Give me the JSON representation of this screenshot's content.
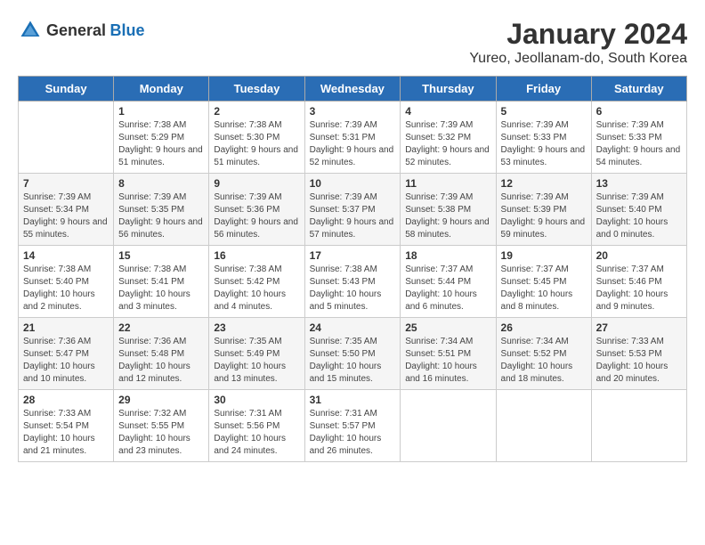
{
  "header": {
    "logo_general": "General",
    "logo_blue": "Blue",
    "month": "January 2024",
    "location": "Yureo, Jeollanam-do, South Korea"
  },
  "weekdays": [
    "Sunday",
    "Monday",
    "Tuesday",
    "Wednesday",
    "Thursday",
    "Friday",
    "Saturday"
  ],
  "weeks": [
    [
      {
        "day": "",
        "sunrise": "",
        "sunset": "",
        "daylight": ""
      },
      {
        "day": "1",
        "sunrise": "Sunrise: 7:38 AM",
        "sunset": "Sunset: 5:29 PM",
        "daylight": "Daylight: 9 hours and 51 minutes."
      },
      {
        "day": "2",
        "sunrise": "Sunrise: 7:38 AM",
        "sunset": "Sunset: 5:30 PM",
        "daylight": "Daylight: 9 hours and 51 minutes."
      },
      {
        "day": "3",
        "sunrise": "Sunrise: 7:39 AM",
        "sunset": "Sunset: 5:31 PM",
        "daylight": "Daylight: 9 hours and 52 minutes."
      },
      {
        "day": "4",
        "sunrise": "Sunrise: 7:39 AM",
        "sunset": "Sunset: 5:32 PM",
        "daylight": "Daylight: 9 hours and 52 minutes."
      },
      {
        "day": "5",
        "sunrise": "Sunrise: 7:39 AM",
        "sunset": "Sunset: 5:33 PM",
        "daylight": "Daylight: 9 hours and 53 minutes."
      },
      {
        "day": "6",
        "sunrise": "Sunrise: 7:39 AM",
        "sunset": "Sunset: 5:33 PM",
        "daylight": "Daylight: 9 hours and 54 minutes."
      }
    ],
    [
      {
        "day": "7",
        "sunrise": "Sunrise: 7:39 AM",
        "sunset": "Sunset: 5:34 PM",
        "daylight": "Daylight: 9 hours and 55 minutes."
      },
      {
        "day": "8",
        "sunrise": "Sunrise: 7:39 AM",
        "sunset": "Sunset: 5:35 PM",
        "daylight": "Daylight: 9 hours and 56 minutes."
      },
      {
        "day": "9",
        "sunrise": "Sunrise: 7:39 AM",
        "sunset": "Sunset: 5:36 PM",
        "daylight": "Daylight: 9 hours and 56 minutes."
      },
      {
        "day": "10",
        "sunrise": "Sunrise: 7:39 AM",
        "sunset": "Sunset: 5:37 PM",
        "daylight": "Daylight: 9 hours and 57 minutes."
      },
      {
        "day": "11",
        "sunrise": "Sunrise: 7:39 AM",
        "sunset": "Sunset: 5:38 PM",
        "daylight": "Daylight: 9 hours and 58 minutes."
      },
      {
        "day": "12",
        "sunrise": "Sunrise: 7:39 AM",
        "sunset": "Sunset: 5:39 PM",
        "daylight": "Daylight: 9 hours and 59 minutes."
      },
      {
        "day": "13",
        "sunrise": "Sunrise: 7:39 AM",
        "sunset": "Sunset: 5:40 PM",
        "daylight": "Daylight: 10 hours and 0 minutes."
      }
    ],
    [
      {
        "day": "14",
        "sunrise": "Sunrise: 7:38 AM",
        "sunset": "Sunset: 5:40 PM",
        "daylight": "Daylight: 10 hours and 2 minutes."
      },
      {
        "day": "15",
        "sunrise": "Sunrise: 7:38 AM",
        "sunset": "Sunset: 5:41 PM",
        "daylight": "Daylight: 10 hours and 3 minutes."
      },
      {
        "day": "16",
        "sunrise": "Sunrise: 7:38 AM",
        "sunset": "Sunset: 5:42 PM",
        "daylight": "Daylight: 10 hours and 4 minutes."
      },
      {
        "day": "17",
        "sunrise": "Sunrise: 7:38 AM",
        "sunset": "Sunset: 5:43 PM",
        "daylight": "Daylight: 10 hours and 5 minutes."
      },
      {
        "day": "18",
        "sunrise": "Sunrise: 7:37 AM",
        "sunset": "Sunset: 5:44 PM",
        "daylight": "Daylight: 10 hours and 6 minutes."
      },
      {
        "day": "19",
        "sunrise": "Sunrise: 7:37 AM",
        "sunset": "Sunset: 5:45 PM",
        "daylight": "Daylight: 10 hours and 8 minutes."
      },
      {
        "day": "20",
        "sunrise": "Sunrise: 7:37 AM",
        "sunset": "Sunset: 5:46 PM",
        "daylight": "Daylight: 10 hours and 9 minutes."
      }
    ],
    [
      {
        "day": "21",
        "sunrise": "Sunrise: 7:36 AM",
        "sunset": "Sunset: 5:47 PM",
        "daylight": "Daylight: 10 hours and 10 minutes."
      },
      {
        "day": "22",
        "sunrise": "Sunrise: 7:36 AM",
        "sunset": "Sunset: 5:48 PM",
        "daylight": "Daylight: 10 hours and 12 minutes."
      },
      {
        "day": "23",
        "sunrise": "Sunrise: 7:35 AM",
        "sunset": "Sunset: 5:49 PM",
        "daylight": "Daylight: 10 hours and 13 minutes."
      },
      {
        "day": "24",
        "sunrise": "Sunrise: 7:35 AM",
        "sunset": "Sunset: 5:50 PM",
        "daylight": "Daylight: 10 hours and 15 minutes."
      },
      {
        "day": "25",
        "sunrise": "Sunrise: 7:34 AM",
        "sunset": "Sunset: 5:51 PM",
        "daylight": "Daylight: 10 hours and 16 minutes."
      },
      {
        "day": "26",
        "sunrise": "Sunrise: 7:34 AM",
        "sunset": "Sunset: 5:52 PM",
        "daylight": "Daylight: 10 hours and 18 minutes."
      },
      {
        "day": "27",
        "sunrise": "Sunrise: 7:33 AM",
        "sunset": "Sunset: 5:53 PM",
        "daylight": "Daylight: 10 hours and 20 minutes."
      }
    ],
    [
      {
        "day": "28",
        "sunrise": "Sunrise: 7:33 AM",
        "sunset": "Sunset: 5:54 PM",
        "daylight": "Daylight: 10 hours and 21 minutes."
      },
      {
        "day": "29",
        "sunrise": "Sunrise: 7:32 AM",
        "sunset": "Sunset: 5:55 PM",
        "daylight": "Daylight: 10 hours and 23 minutes."
      },
      {
        "day": "30",
        "sunrise": "Sunrise: 7:31 AM",
        "sunset": "Sunset: 5:56 PM",
        "daylight": "Daylight: 10 hours and 24 minutes."
      },
      {
        "day": "31",
        "sunrise": "Sunrise: 7:31 AM",
        "sunset": "Sunset: 5:57 PM",
        "daylight": "Daylight: 10 hours and 26 minutes."
      },
      {
        "day": "",
        "sunrise": "",
        "sunset": "",
        "daylight": ""
      },
      {
        "day": "",
        "sunrise": "",
        "sunset": "",
        "daylight": ""
      },
      {
        "day": "",
        "sunrise": "",
        "sunset": "",
        "daylight": ""
      }
    ]
  ]
}
